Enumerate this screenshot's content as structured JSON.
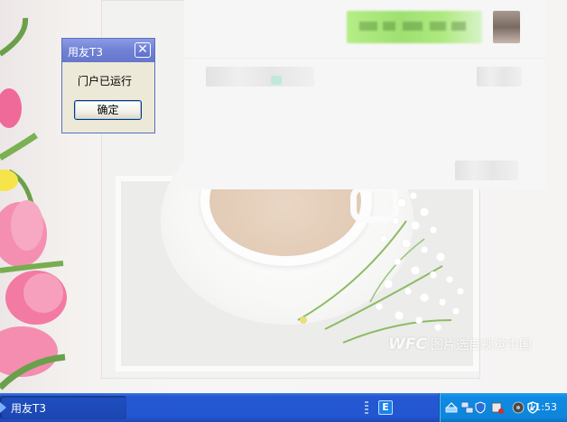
{
  "dialog": {
    "title": "用友T3",
    "close_glyph": "✕",
    "message": "门户已运行",
    "ok_label": "确定"
  },
  "taskbar": {
    "active_task_label": "用友T3",
    "quick_launch_icon": "E",
    "clock": "11:53"
  },
  "wallpaper": {
    "watermark_logo": "WFC",
    "watermark_text": "图片选自视觉中国"
  },
  "tray_icons": [
    "network-icon",
    "network-activity-icon",
    "shield-icon",
    "disk-icon",
    "speaker-icon",
    "security-center-icon"
  ],
  "colors": {
    "taskbar_blue": "#2458d3",
    "tray_blue": "#0f8ae3",
    "dialog_title_blue": "#7283d6",
    "dialog_face": "#ece9d8",
    "overlay_green": "#9fe071"
  }
}
